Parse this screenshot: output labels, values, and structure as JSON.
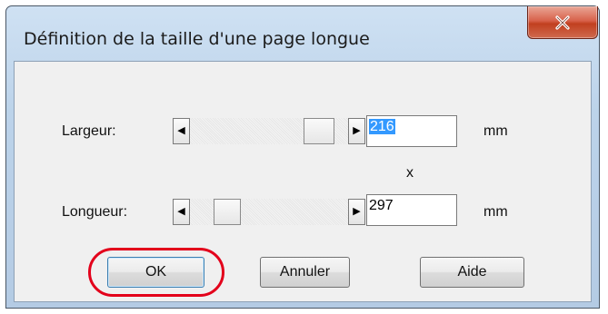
{
  "dialog": {
    "title": "Définition de la taille d'une page longue",
    "close_label": "X"
  },
  "width_row": {
    "label": "Largeur:",
    "value": "216",
    "unit": "mm",
    "left_arrow": "◀",
    "right_arrow": "▶"
  },
  "separator": "x",
  "length_row": {
    "label": "Longueur:",
    "value": "297",
    "unit": "mm",
    "left_arrow": "◀",
    "right_arrow": "▶"
  },
  "buttons": {
    "ok": "OK",
    "cancel": "Annuler",
    "help": "Aide"
  },
  "highlight_color": "#e3001b"
}
